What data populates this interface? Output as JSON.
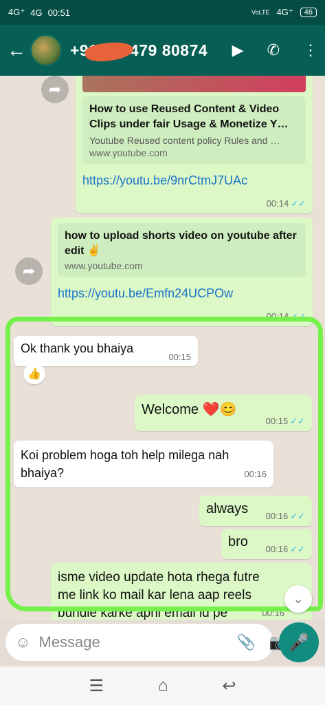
{
  "status": {
    "left_signal_1": "4G⁺",
    "left_signal_2": "4G",
    "time": "00:51",
    "right_volte": "VoLTE",
    "right_network": "4G⁺",
    "battery": "46"
  },
  "header": {
    "contact": "+91 ··· ·479 80874"
  },
  "messages": {
    "m1": {
      "title": "How to use Reused Content & Video Clips under fair Usage & Monetize Y…",
      "desc": "Youtube Reused content policy Rules and …",
      "domain": "www.youtube.com",
      "link": "https://youtu.be/9nrCtmJ7UAc",
      "time": "00:14"
    },
    "m2": {
      "title": "how to upload shorts video on youtube after edit ✌️",
      "domain": "www.youtube.com",
      "link": "https://youtu.be/Emfn24UCPOw",
      "time": "00:14"
    },
    "m3": {
      "text": "Ok thank you bhaiya",
      "time": "00:15",
      "reaction": "👍"
    },
    "m4": {
      "text": "Welcome ❤️😊",
      "time": "00:15"
    },
    "m5": {
      "text": "Koi problem hoga toh help milega nah bhaiya?",
      "time": "00:16"
    },
    "m6": {
      "text": "always",
      "time": "00:16"
    },
    "m7": {
      "text": "bro",
      "time": "00:16"
    },
    "m8": {
      "text": "isme video update hota rhega futre me link ko mail kar lena aap reels bundle karke apni email id pe",
      "time": "00:16"
    }
  },
  "composer": {
    "placeholder": "Message"
  },
  "icons": {
    "back": "arrow-left-icon",
    "video": "video-call-icon",
    "call": "phone-icon",
    "menu": "more-vert-icon",
    "emoji": "emoji-icon",
    "attach": "paperclip-icon",
    "camera": "camera-icon",
    "mic": "mic-icon"
  },
  "colors": {
    "header": "#075e54",
    "outgoing": "#dcf8c6",
    "incoming": "#ffffff",
    "highlight": "#76f04a"
  }
}
